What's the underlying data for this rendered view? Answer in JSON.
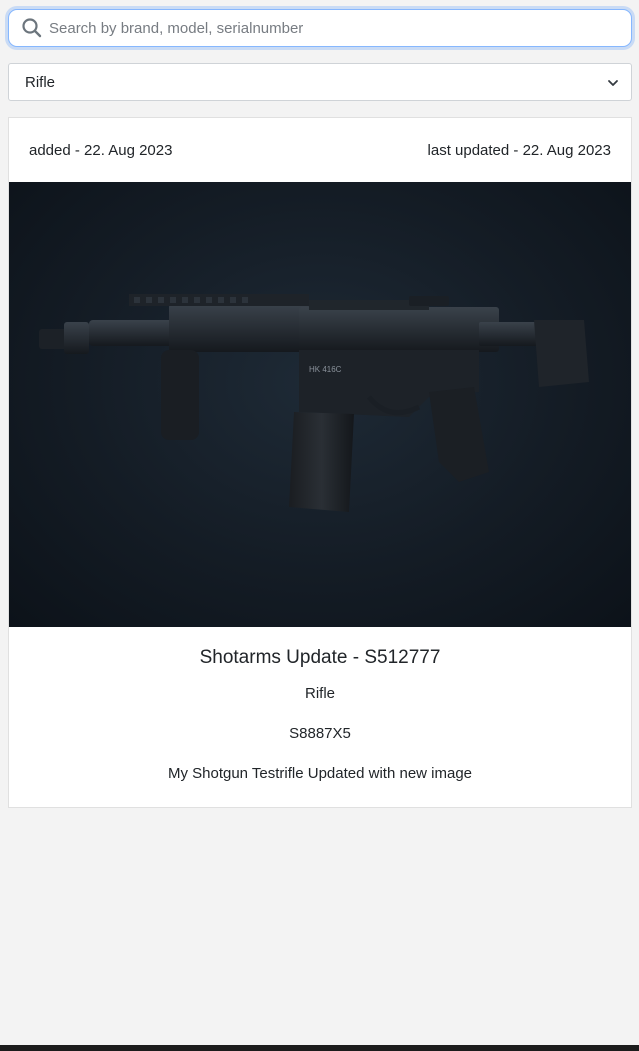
{
  "search": {
    "placeholder": "Search by brand, model, serialnumber",
    "value": ""
  },
  "filter": {
    "selected": "Rifle"
  },
  "card": {
    "added": "added - 22. Aug 2023",
    "updated": "last updated - 22. Aug 2023",
    "image_subject": "HK416 rifle on dark background",
    "title": "Shotarms Update - S512777",
    "type": "Rifle",
    "serial": "S8887X5",
    "description": "My Shotgun Testrifle Updated with new image"
  },
  "colors": {
    "background": "#f3f3f3",
    "card": "#ffffff",
    "focus_border": "#86b7fe",
    "text": "#212529"
  },
  "icons": {
    "search": "search-icon",
    "dropdown": "chevron-down-icon"
  }
}
